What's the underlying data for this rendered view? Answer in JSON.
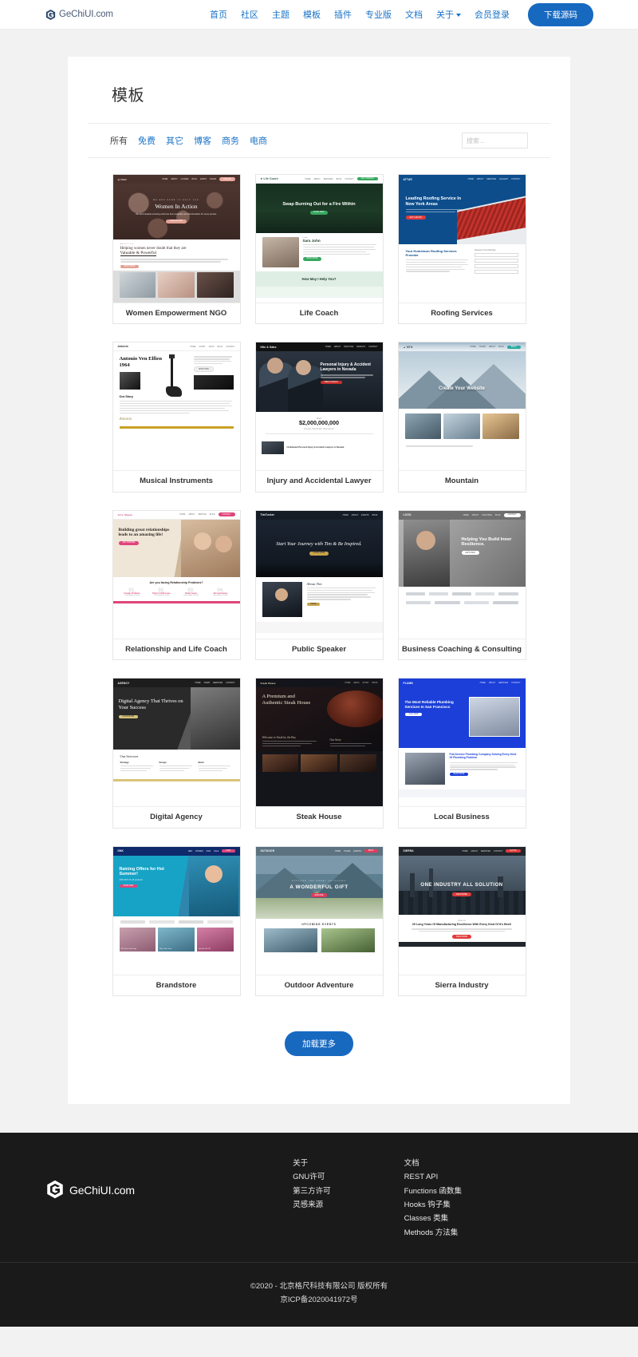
{
  "header": {
    "brand": "GeChiUI.com",
    "nav": [
      {
        "label": "首页",
        "caret": false
      },
      {
        "label": "社区",
        "caret": false
      },
      {
        "label": "主题",
        "caret": false
      },
      {
        "label": "模板",
        "caret": false
      },
      {
        "label": "插件",
        "caret": false
      },
      {
        "label": "专业版",
        "caret": false
      },
      {
        "label": "文档",
        "caret": false
      },
      {
        "label": "关于",
        "caret": true
      },
      {
        "label": "会员登录",
        "caret": false
      }
    ],
    "download_button": "下载源码"
  },
  "main": {
    "title": "模板",
    "filters": [
      {
        "label": "所有",
        "active": true
      },
      {
        "label": "免费",
        "active": false
      },
      {
        "label": "其它",
        "active": false
      },
      {
        "label": "博客",
        "active": false
      },
      {
        "label": "商务",
        "active": false
      },
      {
        "label": "电商",
        "active": false
      }
    ],
    "search_placeholder": "搜索...",
    "search_value": "",
    "load_more": "加载更多",
    "templates": [
      {
        "title": "Women Empowerment NGO",
        "thumb": "women-ngo",
        "hero_title": "Women In Action",
        "hero_sub": "We work towards ensuring a life free from inequality and discrimination for every woman.",
        "body_kicker": "ABOUT US",
        "body_title": "Helping women never doubt that they are",
        "body_em": "Valuable & Powerful"
      },
      {
        "title": "Life Coach",
        "thumb": "life-coach",
        "hero_title": "Swap Burning Out for a Fire Within",
        "hero_cta": "BOOK NOW",
        "person_label": "Coach",
        "person_name": "Sara John",
        "band_text": "How May I Help You?"
      },
      {
        "title": "Roofing Services",
        "thumb": "roofing",
        "logo": "ATTAR",
        "hero_title": "Leading Roofing Service In New York Areas",
        "section_title": "Your Hometown Roofing Services Provider",
        "form_label": "Request A Free Estimate"
      },
      {
        "title": "Musical Instruments",
        "thumb": "musical",
        "logo": "Antonio",
        "hero_title": "Antonio Ven Elfien 1964",
        "section_title": "Our Story"
      },
      {
        "title": "Injury and Accidental Lawyer",
        "thumb": "lawyer",
        "hero_title": "Personal Injury & Accident Lawyers in Nevada",
        "stat_label": "Client",
        "stat_value": "$2,000,000,000",
        "stat_sub": "Covered, Hard fought. Hard earned.",
        "footer_text": "Undefeated Personal Injury & Accident Lawyers in Nevada"
      },
      {
        "title": "Mountain",
        "thumb": "mountain",
        "hero_title": "Create Your Website"
      },
      {
        "title": "Relationship and Life Coach",
        "thumb": "relationship",
        "logo": "Love Wagon",
        "hero_title": "Building great relationships leads to an amazing life!",
        "section_title": "Are you facing Relationship Problems?",
        "steps": [
          {
            "num": "01.",
            "label": "Couples Problems",
            "sub": "Consultation & Guide"
          },
          {
            "num": "02.",
            "label": "Parent / Child Issues",
            "sub": "Consultation & Guide"
          },
          {
            "num": "03.",
            "label": "Family Issues",
            "sub": "Consultation & Guide"
          },
          {
            "num": "04.",
            "label": "Personal Issues",
            "sub": "Consultation & Guide"
          }
        ]
      },
      {
        "title": "Public Speaker",
        "thumb": "speaker",
        "logo": "TimTucker",
        "hero_title": "Start Your Journey with Tim & Be Inspired.",
        "hero_cta": "KNOW MORE",
        "section_title": "About Tim"
      },
      {
        "title": "Business Coaching & Consulting",
        "thumb": "business-coach",
        "hero_title": "Helping You Build Inner Resilience."
      },
      {
        "title": "Digital Agency",
        "thumb": "digital-agency",
        "hero_title": "Digital Agency That Thrives on Your Success",
        "hero_cta": "KNOW MORE",
        "section_title": "Our Services",
        "services": [
          "Strategy",
          "Design",
          "Build"
        ]
      },
      {
        "title": "Steak House",
        "thumb": "steak",
        "logo": "Steak House",
        "hero_title": "A Premium and Authentic Steak House",
        "section_title": "Welcome to Steak by the Bay",
        "section_title2": "Our Story"
      },
      {
        "title": "Local Business",
        "thumb": "local-business",
        "hero_title": "The Most Reliable Plumbing Services In San Francisco",
        "section_title": "Full-Service Plumbing Company Solving Every Kind Of Plumbing Problem"
      },
      {
        "title": "Brandstore",
        "thumb": "brandstore",
        "logo": "DNK",
        "hero_title": "Raining Offers for Hot Summer!",
        "hero_sub": "20% OFF On all products",
        "hero_cta": "SHOP NOW",
        "cards": [
          "20% Off on Tank Tops",
          "Buy 1 Get 1 Free",
          "Get Flat 15% Off"
        ]
      },
      {
        "title": "Outdoor Adventure",
        "thumb": "outdoor",
        "hero_kicker": "EXPLORE THE GREAT OUTDOORS",
        "hero_title": "A WONDERFUL GIFT",
        "hero_cta": "EXPLORE",
        "section_title": "UPCOMING EVENTS"
      },
      {
        "title": "Sierra Industry",
        "thumb": "sierra",
        "logo": "SIERRA",
        "hero_title": "ONE INDUSTRY ALL SOLUTION",
        "hero_cta": "READ MORE",
        "section_kicker": "About Us",
        "section_title": "25 Long Years Of Manufacturing Excellence With Every Kind Of It's Best!",
        "section_cta": "READ MORE"
      }
    ]
  },
  "footer": {
    "brand": "GeChiUI.com",
    "columns": [
      {
        "links": [
          "关于",
          "GNU许可",
          "第三方许可",
          "灵感来源"
        ]
      },
      {
        "links": [
          "文档",
          "REST API",
          "Functions 函数集",
          "Hooks 钩子集",
          "Classes 类集",
          "Methods 方法集"
        ]
      }
    ],
    "copyright": "©2020 - 北京格尺科技有限公司 版权所有",
    "icp": "京ICP备2020041972号"
  },
  "colors": {
    "accent": "#1769c0",
    "link": "#1a73c7",
    "footer_bg": "#1a1a1a",
    "page_bg": "#f2f2f2"
  }
}
